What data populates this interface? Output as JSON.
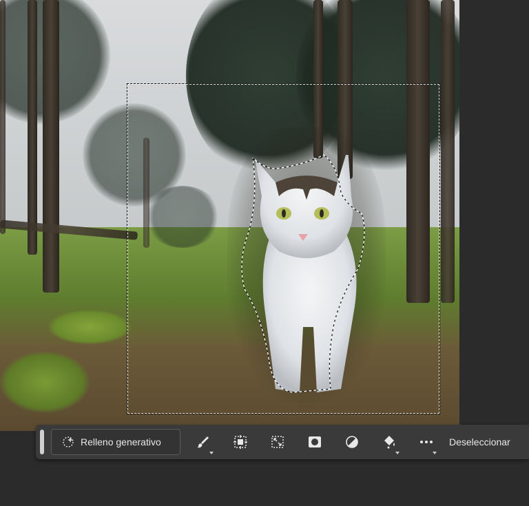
{
  "toolbar": {
    "generative_fill_label": "Relleno generativo",
    "deselect_label": "Deseleccionar",
    "tools": [
      {
        "name": "brush-icon",
        "has_dropdown": true
      },
      {
        "name": "expand-selection-icon",
        "has_dropdown": false
      },
      {
        "name": "transform-selection-icon",
        "has_dropdown": false
      },
      {
        "name": "mask-icon",
        "has_dropdown": false
      },
      {
        "name": "invert-selection-icon",
        "has_dropdown": false
      },
      {
        "name": "fill-bucket-icon",
        "has_dropdown": true
      },
      {
        "name": "more-options-icon",
        "has_dropdown": true
      }
    ]
  },
  "colors": {
    "app_background": "#2b2b2b",
    "toolbar_background": "#3a3a3a",
    "toolbar_text": "#e8e8e8"
  }
}
